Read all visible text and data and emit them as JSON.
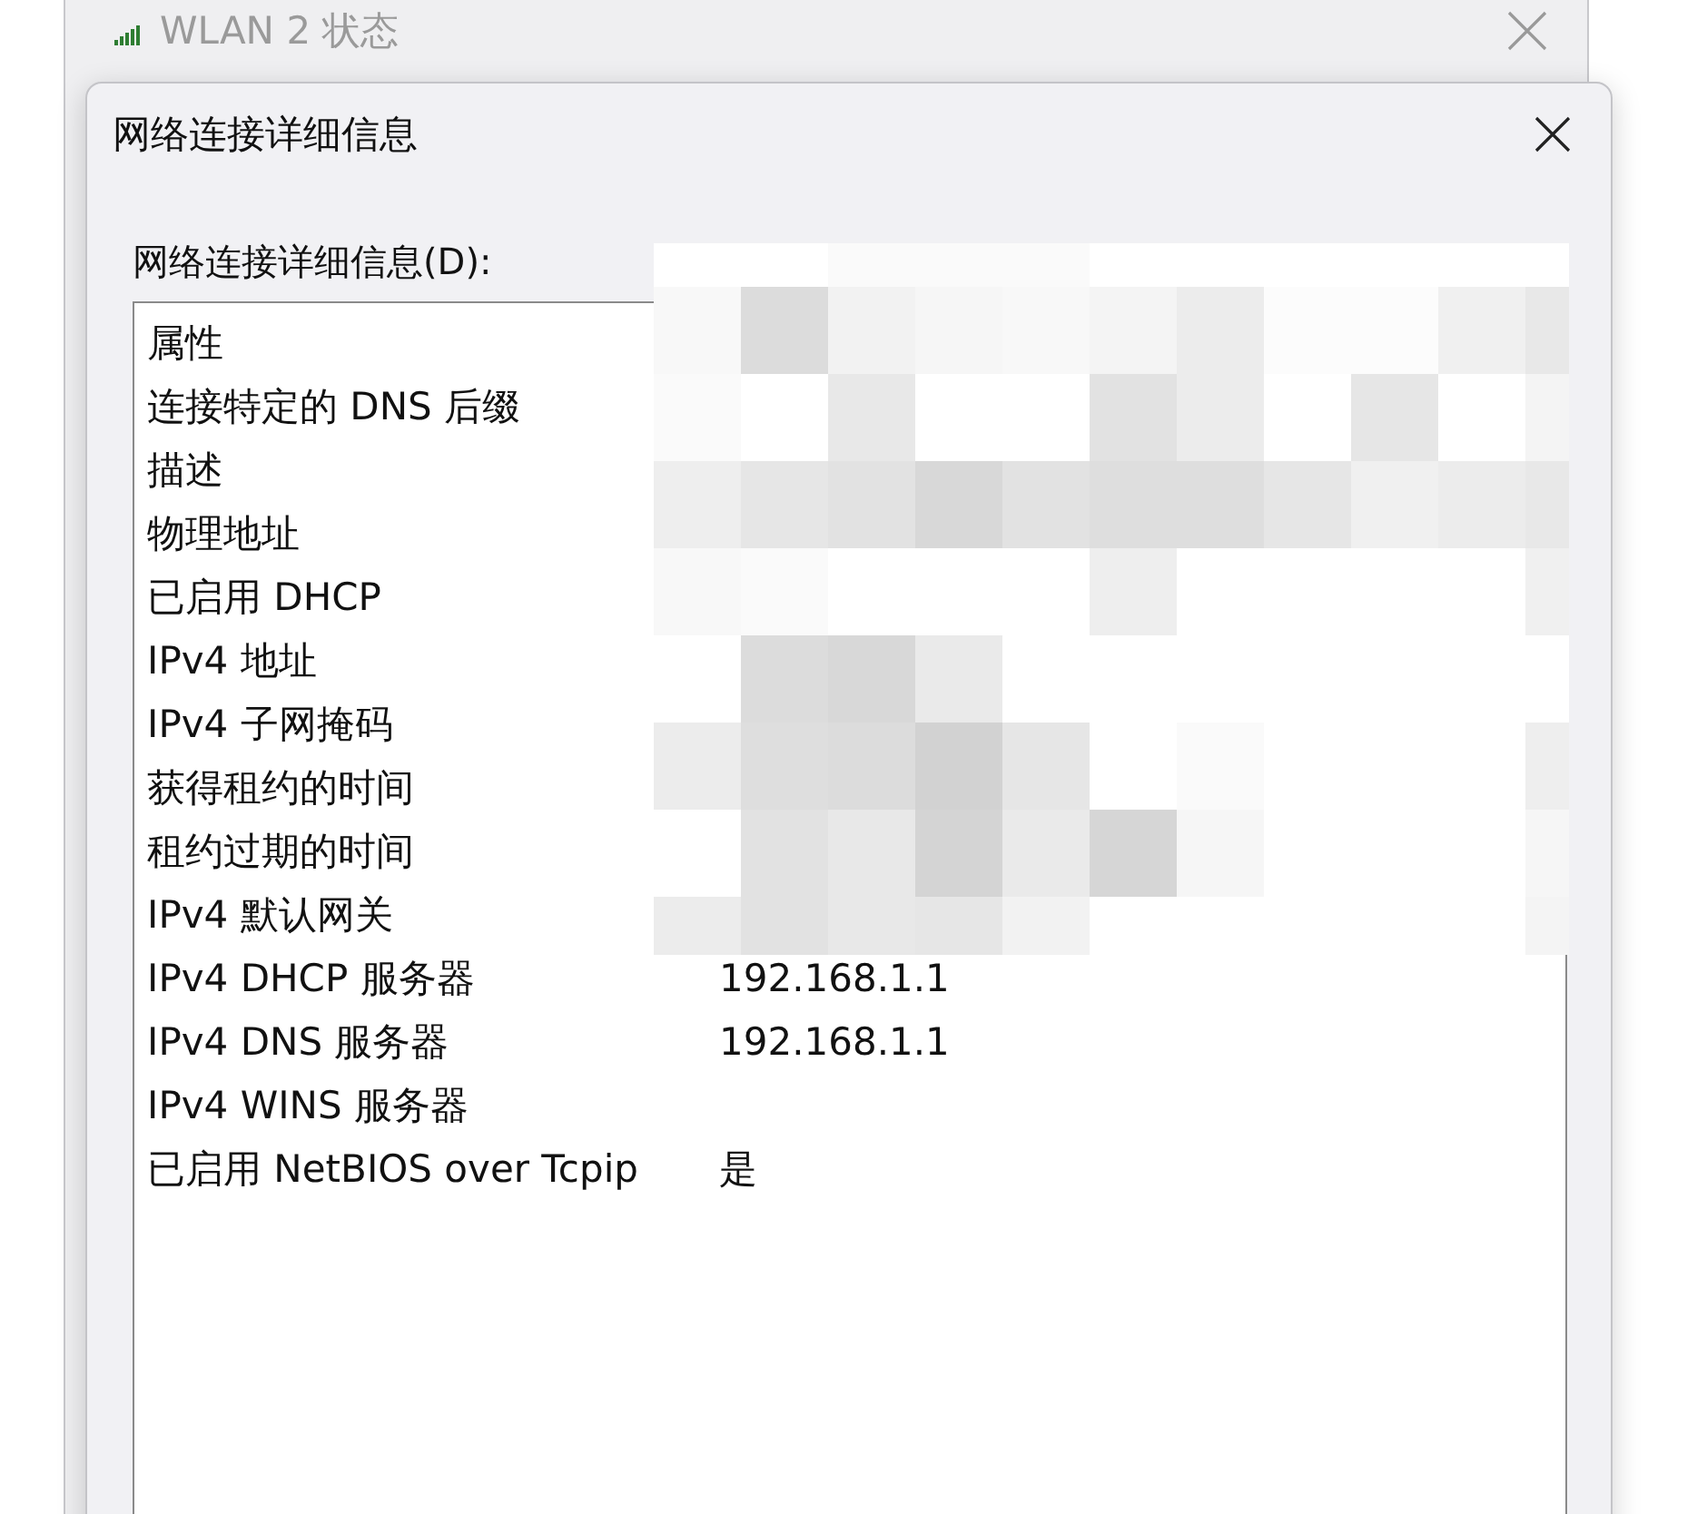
{
  "background_window": {
    "title": "WLAN 2 状态"
  },
  "dialog": {
    "title": "网络连接详细信息",
    "list_label": "网络连接详细信息(D):",
    "header": "属性",
    "rows": [
      {
        "property": "连接特定的 DNS 后缀"
      },
      {
        "property": "描述"
      },
      {
        "property": "物理地址"
      },
      {
        "property": "已启用 DHCP"
      },
      {
        "property": "IPv4 地址"
      },
      {
        "property": "IPv4 子网掩码"
      },
      {
        "property": "获得租约的时间"
      },
      {
        "property": "租约过期的时间"
      },
      {
        "property": "IPv4 默认网关"
      },
      {
        "property": "IPv4 DHCP 服务器",
        "value": "192.168.1.1"
      },
      {
        "property": "IPv4 DNS 服务器",
        "value": "192.168.1.1"
      },
      {
        "property": "IPv4 WINS 服务器"
      },
      {
        "property": "已启用 NetBIOS over Tcpip",
        "value": "是"
      }
    ]
  }
}
